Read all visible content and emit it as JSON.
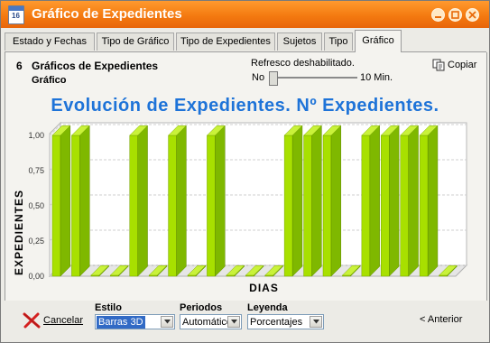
{
  "window": {
    "icon_label": "16",
    "title": "Gráfico de Expedientes"
  },
  "tabs": [
    {
      "label": "Estado y Fechas",
      "active": false
    },
    {
      "label": "Tipo de Gráfico",
      "active": false
    },
    {
      "label": "Tipo de Expedientes",
      "active": false
    },
    {
      "label": "Sujetos",
      "active": false
    },
    {
      "label": "Tipo",
      "active": false
    },
    {
      "label": "Gráfico",
      "active": true
    }
  ],
  "header": {
    "number": "6",
    "title": "Gráficos de Expedientes",
    "subtitle": "Gráfico"
  },
  "refresh": {
    "label": "Refresco deshabilitado.",
    "min_label": "No",
    "max_label": "10 Min.",
    "value": 0
  },
  "copy_label": "Copiar",
  "chart_data": {
    "type": "bar",
    "title": "Evolución de Expedientes.  Nº Expedientes.",
    "xlabel": "DIAS",
    "ylabel": "EXPEDIENTES",
    "ylim": [
      0,
      1
    ],
    "yticks": [
      "0,00",
      "0,25",
      "0,50",
      "0,75",
      "1,00"
    ],
    "three_d": true,
    "grid": true,
    "bar_color": "#a8e000",
    "values": [
      1,
      1,
      0,
      0,
      1,
      0,
      1,
      0,
      1,
      0,
      0,
      0,
      1,
      1,
      1,
      0,
      1,
      1,
      1,
      1,
      0
    ]
  },
  "footer": {
    "cancel_label": "Cancelar",
    "estilo_label": "Estilo",
    "estilo_value": "Barras 3D",
    "periodos_label": "Periodos",
    "periodos_value": "Automático",
    "leyenda_label": "Leyenda",
    "leyenda_value": "Porcentajes",
    "back_label": "< Anterior"
  },
  "colors": {
    "titlebar": "#f47a10",
    "title_text": "#1e73d8",
    "bar": "#a8e000"
  }
}
